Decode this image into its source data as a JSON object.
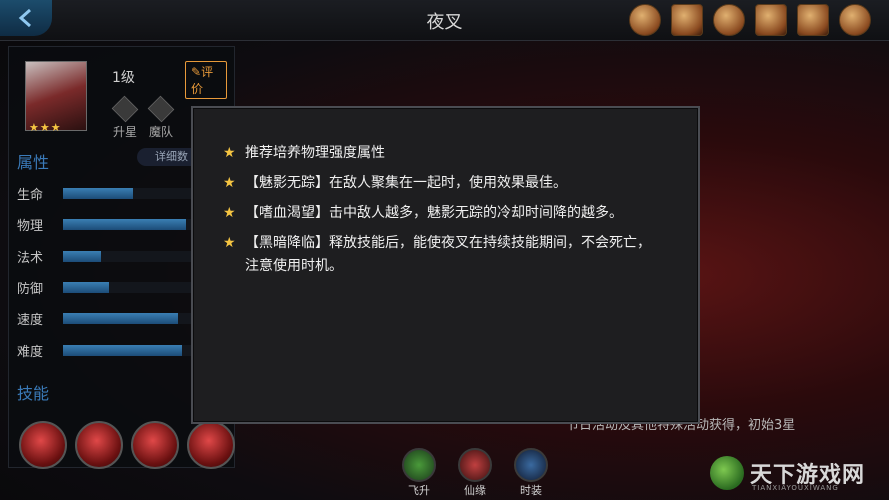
{
  "header": {
    "title": "夜叉"
  },
  "hero": {
    "stars": "★★★",
    "level": "1级",
    "eval_label": "评价",
    "actions": [
      "升星",
      "魔队"
    ]
  },
  "attributes": {
    "title": "属性",
    "detail_label": "详细数",
    "items": [
      {
        "label": "生命",
        "level": 0.5
      },
      {
        "label": "物理",
        "level": 0.88
      },
      {
        "label": "法术",
        "level": 0.27
      },
      {
        "label": "防御",
        "level": 0.33
      },
      {
        "label": "速度",
        "level": 0.82
      },
      {
        "label": "难度",
        "level": 0.85
      }
    ]
  },
  "skills": {
    "title": "技能",
    "count": 4
  },
  "modal": {
    "tips": [
      "推荐培养物理强度属性",
      "【魅影无踪】在敌人聚集在一起时，使用效果最佳。",
      "【嗜血渴望】击中敌人越多，魅影无踪的冷却时间降的越多。",
      "【黑暗降临】释放技能后，能使夜叉在持续技能期间，不会死亡，注意使用时机。"
    ]
  },
  "bottom": {
    "note": "节日活动及其他特殊活动获得，初始3星",
    "tabs": [
      "飞升",
      "仙缘",
      "时装"
    ]
  },
  "watermark": {
    "text": "天下游戏网",
    "sub": "TIANXIAYOUXIWANG"
  },
  "colors": {
    "accent_blue": "#3a7ab8",
    "star_gold": "#f5c542",
    "eval_orange": "#e89a3a"
  }
}
